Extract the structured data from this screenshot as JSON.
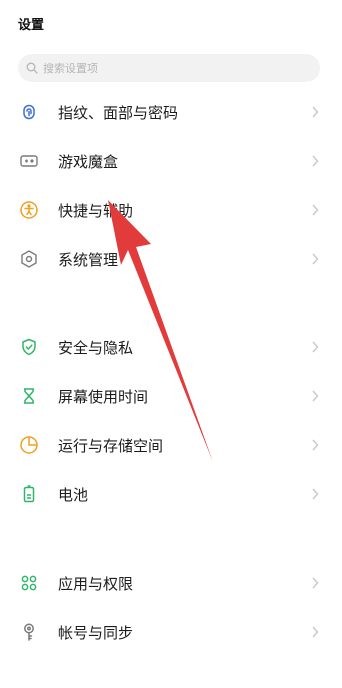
{
  "header": {
    "title": "设置"
  },
  "search": {
    "placeholder": "搜索设置项"
  },
  "items": [
    {
      "label": "指纹、面部与密码",
      "icon": "fingerprint-icon"
    },
    {
      "label": "游戏魔盒",
      "icon": "game-box-icon"
    },
    {
      "label": "快捷与辅助",
      "icon": "accessibility-icon"
    },
    {
      "label": "系统管理",
      "icon": "system-hexagon-icon"
    },
    {
      "label": "安全与隐私",
      "icon": "shield-check-icon"
    },
    {
      "label": "屏幕使用时间",
      "icon": "hourglass-icon"
    },
    {
      "label": "运行与存储空间",
      "icon": "pie-storage-icon"
    },
    {
      "label": "电池",
      "icon": "battery-icon"
    },
    {
      "label": "应用与权限",
      "icon": "apps-grid-icon"
    },
    {
      "label": "帐号与同步",
      "icon": "account-key-icon"
    }
  ],
  "colors": {
    "blue_icon": "#3f6fd6",
    "gray_icon": "#7a7a7a",
    "orange_icon": "#f0a020",
    "green_icon": "#2fb66a",
    "annotation_arrow": "#e23b3b"
  }
}
